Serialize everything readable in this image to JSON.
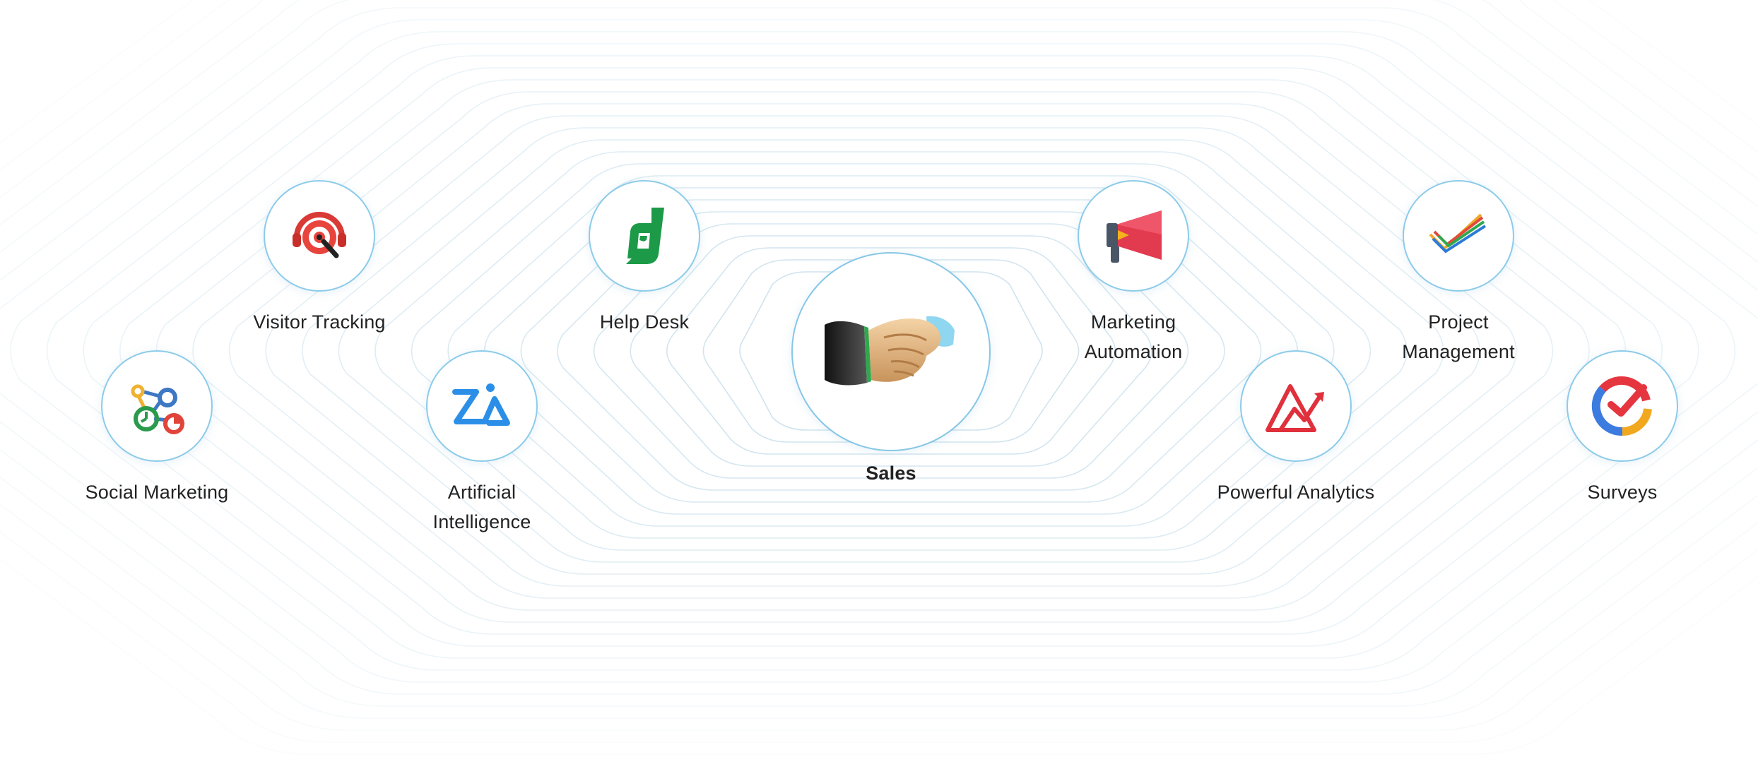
{
  "center": {
    "label": "Sales",
    "icon": "handshake-icon"
  },
  "nodes": [
    {
      "id": "social-marketing",
      "label": "Social Marketing",
      "icon": "social-network-icon"
    },
    {
      "id": "visitor-tracking",
      "label": "Visitor Tracking",
      "icon": "target-headset-icon"
    },
    {
      "id": "artificial-intelligence",
      "label": "Artificial Intelligence",
      "icon": "zia-icon"
    },
    {
      "id": "help-desk",
      "label": "Help Desk",
      "icon": "desk-d-icon"
    },
    {
      "id": "marketing-automation",
      "label": "Marketing Automation",
      "icon": "megaphone-icon"
    },
    {
      "id": "powerful-analytics",
      "label": "Powerful Analytics",
      "icon": "analytics-mountain-icon"
    },
    {
      "id": "project-management",
      "label": "Project Management",
      "icon": "checkmark-icon"
    },
    {
      "id": "surveys",
      "label": "Surveys",
      "icon": "survey-check-icon"
    }
  ],
  "colors": {
    "circle_border": "#8ccbe9",
    "ring_line": "#cfe3ee",
    "label_text": "#222222"
  }
}
